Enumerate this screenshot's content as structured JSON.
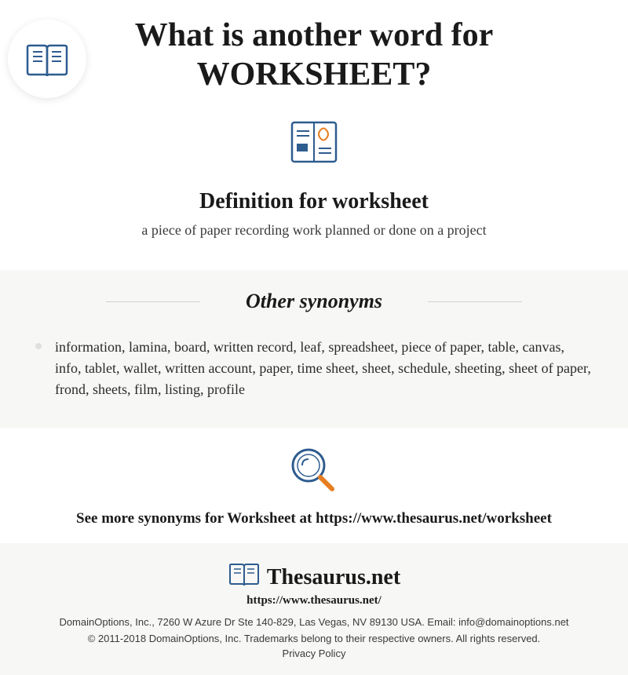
{
  "header": {
    "title_prefix": "What is another word for ",
    "title_word": "WORKSHEET?",
    "definition_heading": "Definition for worksheet",
    "definition_text": "a piece of paper recording work planned or done on a project"
  },
  "synonyms": {
    "heading": "Other synonyms",
    "list": "information, lamina, board, written record, leaf, spreadsheet, piece of paper, table, canvas, info, tablet, wallet, written account, paper, time sheet, sheet, schedule, sheeting, sheet of paper, frond, sheets, film, listing, profile"
  },
  "see_more": {
    "text": "See more synonyms for Worksheet at https://www.thesaurus.net/worksheet"
  },
  "footer": {
    "brand": "Thesaurus.net",
    "url": "https://www.thesaurus.net/",
    "domain": "DomainOptions, Inc., 7260 W Azure Dr Ste 140-829, Las Vegas, NV 89130 USA. Email: info@domainoptions.net",
    "copyright": "© 2011-2018 DomainOptions, Inc. Trademarks belong to their respective owners. All rights reserved.",
    "privacy": "Privacy Policy"
  },
  "colors": {
    "accent_blue": "#2e5c8f",
    "accent_orange": "#e67e22"
  }
}
